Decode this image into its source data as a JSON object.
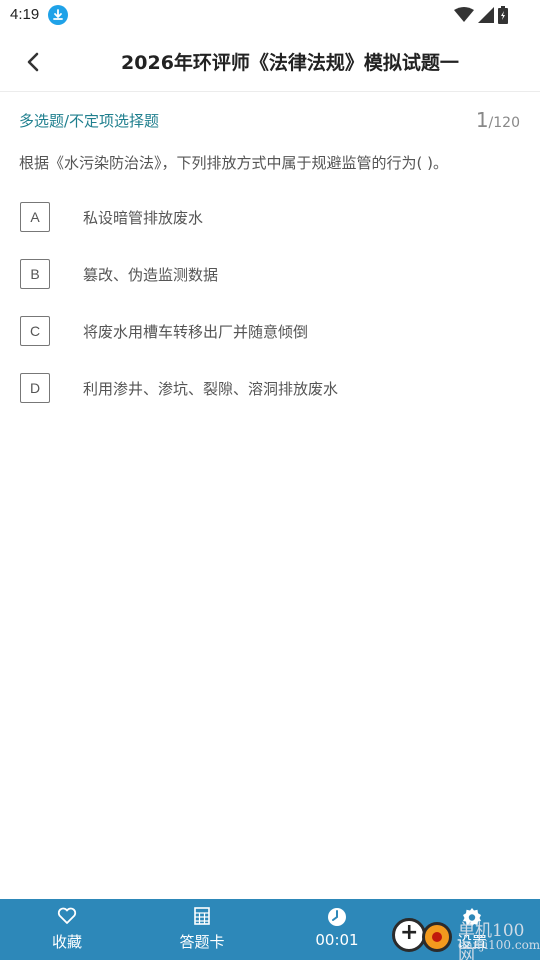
{
  "status": {
    "time": "4:19",
    "icons": [
      "download-icon",
      "wifi-icon",
      "signal-icon",
      "battery-icon"
    ]
  },
  "header": {
    "back_icon": "chevron-left-icon",
    "title": "2026年环评师《法律法规》模拟试题一"
  },
  "question": {
    "type": "多选题/不定项选择题",
    "current": "1",
    "total": "/120",
    "text": "根据《水污染防治法》，下列排放方式中属于规避监管的行为(    )。",
    "options": [
      {
        "letter": "A",
        "text": "私设暗管排放废水"
      },
      {
        "letter": "B",
        "text": "篡改、伪造监测数据"
      },
      {
        "letter": "C",
        "text": "将废水用槽车转移出厂并随意倾倒"
      },
      {
        "letter": "D",
        "text": "利用渗井、渗坑、裂隙、溶洞排放废水"
      }
    ]
  },
  "bottom_bar": {
    "tabs": [
      {
        "label": "收藏",
        "icon": "heart-icon"
      },
      {
        "label": "答题卡",
        "icon": "grid-card-icon"
      },
      {
        "label": "00:01",
        "icon": "clock-icon"
      },
      {
        "label": "设置",
        "icon": "gear-icon"
      }
    ]
  },
  "watermark": {
    "name": "单机100网",
    "url": "danji100.com"
  },
  "colors": {
    "accent": "#1f7f8e",
    "bottom_bar": "#2d88b9"
  }
}
